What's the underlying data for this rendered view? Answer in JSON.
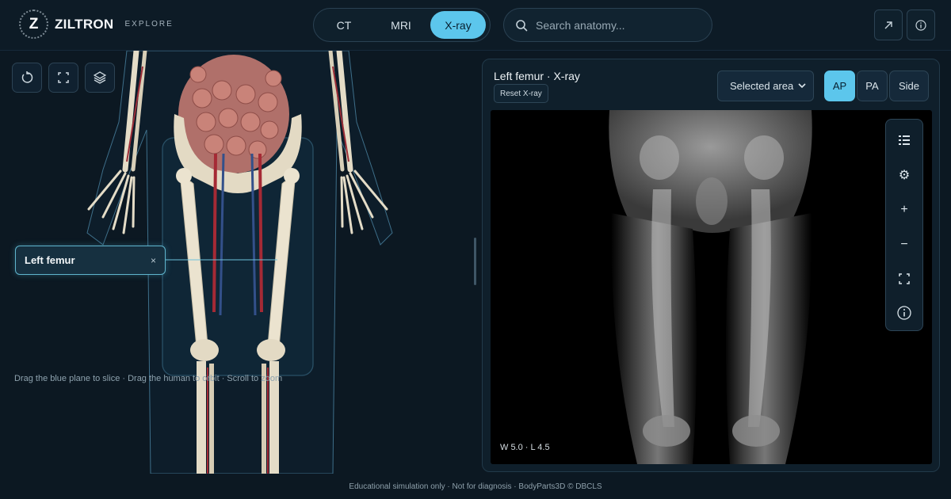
{
  "brand": {
    "logo_letter": "Z",
    "name": "ZILTRON",
    "subtitle": "EXPLORE"
  },
  "modality_tabs": [
    {
      "label": "CT",
      "active": false
    },
    {
      "label": "MRI",
      "active": false
    },
    {
      "label": "X-ray",
      "active": true
    }
  ],
  "search": {
    "placeholder": "Search anatomy..."
  },
  "header_actions": [
    {
      "icon": "external-link-icon"
    },
    {
      "icon": "info-icon"
    }
  ],
  "viewer": {
    "tools": [
      "reset-rotation-icon",
      "fullscreen-icon",
      "layers-icon"
    ],
    "selected_label": "Left femur",
    "close_glyph": "×",
    "hint": "Drag the blue plane to slice · Drag the human to orbit · Scroll to zoom"
  },
  "panel": {
    "title": "Left femur · X-ray",
    "reset_label": "Reset X-ray",
    "select_value": "Selected area",
    "views": [
      {
        "label": "AP",
        "active": true
      },
      {
        "label": "PA",
        "active": false
      },
      {
        "label": "Side",
        "active": false
      }
    ],
    "window_level": "W 5.0 · L 4.5",
    "side_tools": [
      "list-icon",
      "settings-icon",
      "zoom-in-icon",
      "zoom-out-icon",
      "fit-icon",
      "info-icon"
    ]
  },
  "footer": {
    "text": "Educational simulation only · Not for diagnosis · BodyParts3D © DBCLS"
  },
  "colors": {
    "accent": "#5cc6ec",
    "background": "#0c1822",
    "panel": "#0f1f2b"
  }
}
